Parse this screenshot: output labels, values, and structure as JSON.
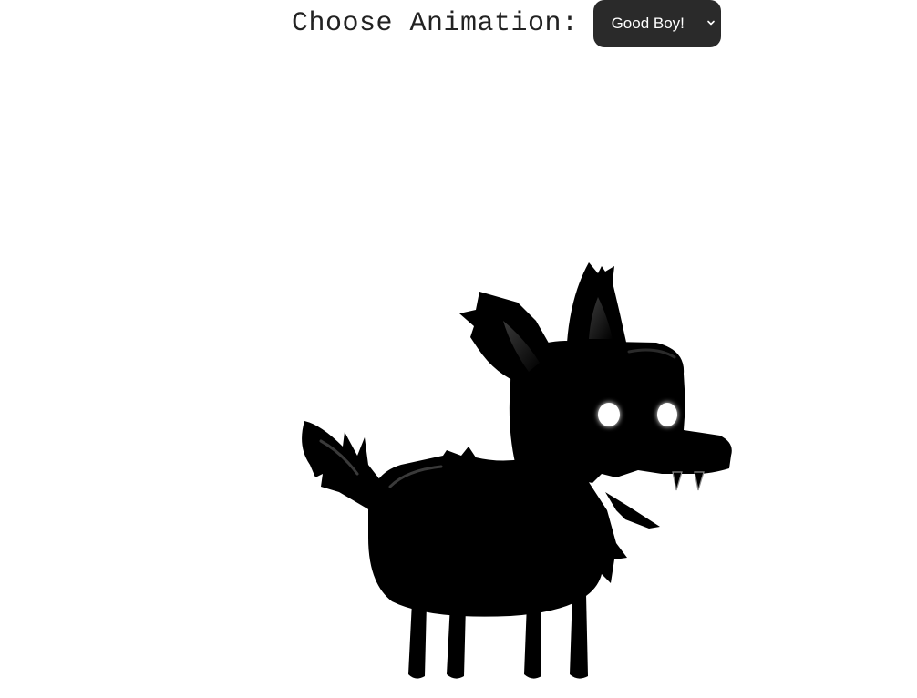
{
  "header": {
    "label": "Choose Animation:",
    "select": {
      "selected": "Good Boy!"
    }
  },
  "colors": {
    "select_bg": "#2a2a2a",
    "select_text": "#ffffff",
    "creature_body": "#000000",
    "eye_glow": "#ffffff"
  },
  "icons": {
    "dropdown": "chevron-down-icon"
  }
}
